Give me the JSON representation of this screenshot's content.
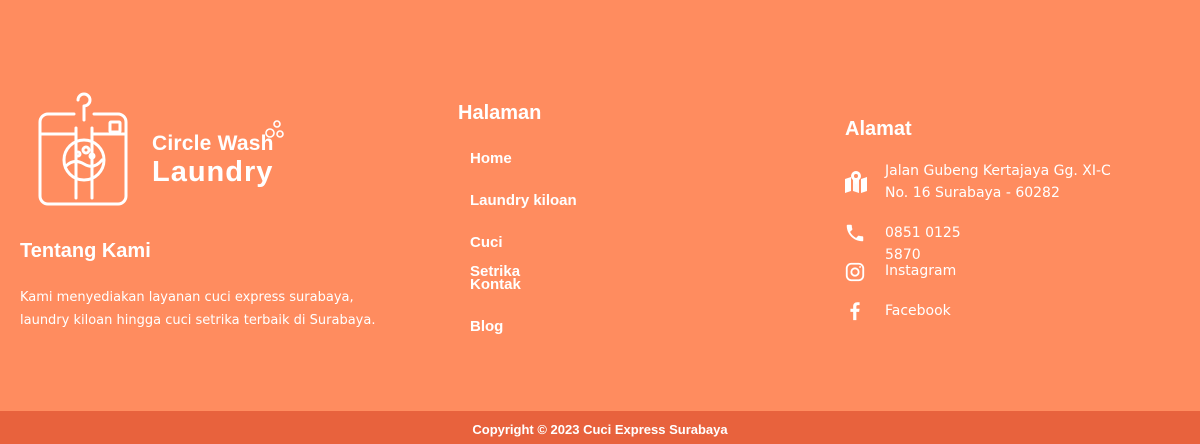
{
  "brand": {
    "name_line1": "Circle Wash",
    "name_line2": "Laundry"
  },
  "about": {
    "title": "Tentang Kami",
    "text": "Kami menyediakan layanan cuci express surabaya, laundry kiloan hingga cuci setrika terbaik di Surabaya."
  },
  "pages": {
    "title": "Halaman",
    "items": [
      "Home",
      "Laundry kiloan",
      "Cuci",
      "Setrika",
      "Kontak",
      "Blog"
    ]
  },
  "address": {
    "title": "Alamat",
    "street_line1": "Jalan Gubeng Kertajaya Gg. XI-C",
    "street_line2": "No. 16 Surabaya - 60282",
    "phone_line1": "0851 0125",
    "phone_line2": "5870",
    "instagram": "Instagram",
    "facebook": "Facebook"
  },
  "icons": {
    "map": "map-icon",
    "phone": "phone-icon",
    "instagram": "instagram-icon",
    "facebook": "facebook-icon"
  },
  "colors": {
    "background": "#ff8c5f",
    "copyright_bar": "#e8623d",
    "text": "#ffffff"
  },
  "copyright": "Copyright © 2023 Cuci Express Surabaya"
}
